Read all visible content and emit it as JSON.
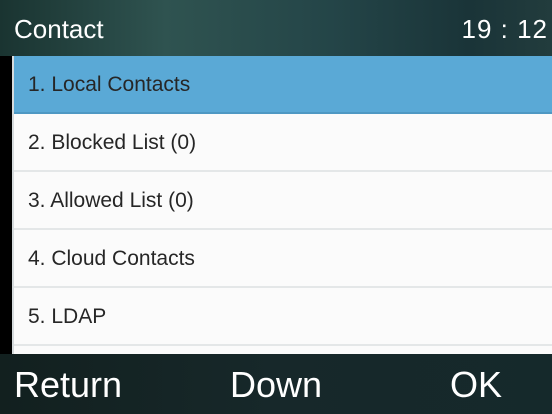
{
  "header": {
    "title": "Contact",
    "time": "19 : 12"
  },
  "menu": {
    "selected_index": 0,
    "items": [
      {
        "label": "1. Local Contacts"
      },
      {
        "label": "2. Blocked List (0)"
      },
      {
        "label": "3. Allowed List (0)"
      },
      {
        "label": "4. Cloud Contacts"
      },
      {
        "label": "5. LDAP"
      }
    ]
  },
  "softkeys": {
    "left": "Return",
    "middle": "Down",
    "right": "OK"
  },
  "colors": {
    "selection": "#5aa9d6",
    "list_background": "#fbfbfb",
    "header_background": "#2f5350",
    "softkey_background": "#17282a"
  }
}
